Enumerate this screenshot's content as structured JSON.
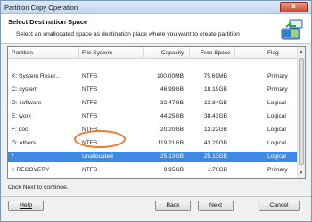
{
  "window": {
    "title": "Partition Copy Operation",
    "close_label": "×"
  },
  "header": {
    "title": "Select Destination Space",
    "subtitle": "Select an unallocated space as destination place where you want to create partition",
    "icon": "partition-copy-icon"
  },
  "table": {
    "columns": [
      "Partition",
      "File System",
      "Capacity",
      "Free Space",
      "Flag"
    ],
    "rows": [
      {
        "partition": "K:  System Reser...",
        "fs": "NTFS",
        "capacity": "100.00MB",
        "free": "75.69MB",
        "flag": "Primary"
      },
      {
        "partition": "C:  system",
        "fs": "NTFS",
        "capacity": "46.99GB",
        "free": "18.19GB",
        "flag": "Primary"
      },
      {
        "partition": "D:  software",
        "fs": "NTFS",
        "capacity": "32.47GB",
        "free": "13.84GB",
        "flag": "Logical"
      },
      {
        "partition": "E:  work",
        "fs": "NTFS",
        "capacity": "44.25GB",
        "free": "38.43GB",
        "flag": "Logical"
      },
      {
        "partition": "F:  doc",
        "fs": "NTFS",
        "capacity": "20.20GB",
        "free": "13.22GB",
        "flag": "Logical"
      },
      {
        "partition": "G:  others",
        "fs": "NTFS",
        "capacity": "119.21GB",
        "free": "43.29GB",
        "flag": "Logical"
      },
      {
        "partition": "*",
        "fs": "Unallocated",
        "capacity": "25.13GB",
        "free": "25.13GB",
        "flag": "Logical"
      },
      {
        "partition": "I:  RECOVERY",
        "fs": "NTFS",
        "capacity": "9.95GB",
        "free": "1.70GB",
        "flag": "Primary"
      }
    ]
  },
  "status": "Click Next to continue.",
  "buttons": {
    "help": "Help",
    "back": "Back",
    "next": "Next",
    "cancel": "Cancel"
  }
}
